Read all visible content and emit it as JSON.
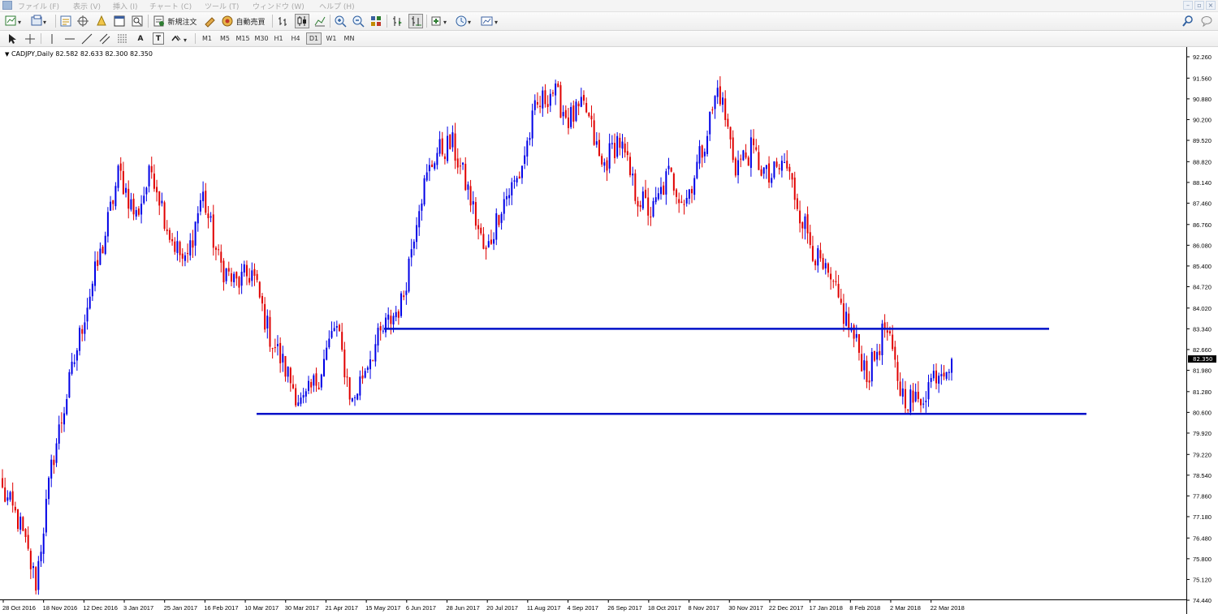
{
  "menubar": {
    "items": [
      "ファイル (F)",
      "表示 (V)",
      "挿入 (I)",
      "チャート (C)",
      "ツール (T)",
      "ウィンドウ (W)",
      "ヘルプ (H)"
    ],
    "window_controls": [
      "minimize",
      "restore",
      "close"
    ]
  },
  "toolbar": {
    "new_order_label": "新規注文",
    "auto_trading_label": "自動売買",
    "icons": [
      "new-chart-icon",
      "profiles-icon",
      "market-watch-icon",
      "data-window-icon",
      "navigator-icon",
      "terminal-icon",
      "tester-icon",
      "bar-chart-icon",
      "candlestick-icon",
      "line-chart-icon",
      "zoom-in-icon",
      "zoom-out-icon",
      "tile-windows-icon",
      "chart-shift-icon",
      "auto-scroll-icon",
      "indicators-icon",
      "periods-icon",
      "templates-icon",
      "search-icon",
      "chat-icon"
    ]
  },
  "drawing_toolbar": {
    "tools": [
      "cursor-icon",
      "crosshair-icon",
      "vertical-line-icon",
      "horizontal-line-icon",
      "trendline-icon",
      "equidistant-channel-icon",
      "fibonacci-icon",
      "text-icon",
      "text-label-icon",
      "arrows-icon"
    ],
    "text_tool_label": "A",
    "label_tool_label": "T",
    "timeframes": [
      "M1",
      "M5",
      "M15",
      "M30",
      "H1",
      "H4",
      "D1",
      "W1",
      "MN"
    ],
    "active_timeframe": "D1"
  },
  "chart": {
    "header": "CADJPY,Daily  82.582 82.633 82.300 82.350",
    "current_price_label": "82.350"
  },
  "colors": {
    "bull": "#0000e6",
    "bear": "#e00000",
    "lines": "#0010c8",
    "price_tag": "#000000"
  },
  "chart_data": {
    "type": "candlestick",
    "symbol": "CADJPY",
    "timeframe": "Daily",
    "ohlc_header": {
      "open": 82.582,
      "high": 82.633,
      "low": 82.3,
      "close": 82.35
    },
    "y_ticks": [
      "92.260",
      "91.560",
      "90.880",
      "90.200",
      "89.520",
      "88.820",
      "88.140",
      "87.460",
      "86.760",
      "86.080",
      "85.400",
      "84.720",
      "84.020",
      "83.340",
      "82.660",
      "81.980",
      "81.280",
      "80.600",
      "79.920",
      "79.220",
      "78.540",
      "77.860",
      "77.180",
      "76.480",
      "75.800",
      "75.120",
      "74.440"
    ],
    "ylim": [
      74.44,
      92.26
    ],
    "x_ticks": [
      "28 Oct 2016",
      "18 Nov 2016",
      "12 Dec 2016",
      "3 Jan 2017",
      "25 Jan 2017",
      "16 Feb 2017",
      "10 Mar 2017",
      "30 Mar 2017",
      "21 Apr 2017",
      "15 May 2017",
      "6 Jun 2017",
      "28 Jun 2017",
      "20 Jul 2017",
      "11 Aug 2017",
      "4 Sep 2017",
      "26 Sep 2017",
      "18 Oct 2017",
      "8 Nov 2017",
      "30 Nov 2017",
      "22 Dec 2017",
      "17 Jan 2018",
      "8 Feb 2018",
      "2 Mar 2018",
      "22 Mar 2018"
    ],
    "key_prices": [
      {
        "date_index": 0,
        "price": 78.0
      },
      {
        "date_index": 1,
        "price": 77.0
      },
      {
        "date_index": 2,
        "price": 75.0
      },
      {
        "date_index": 3,
        "price": 79.0
      },
      {
        "date_index": 4,
        "price": 81.5
      },
      {
        "date_index": 5,
        "price": 84.0
      },
      {
        "date_index": 6,
        "price": 86.0
      },
      {
        "date_index": 7,
        "price": 88.5
      },
      {
        "date_index": 8,
        "price": 87.0
      },
      {
        "date_index": 9,
        "price": 88.6
      },
      {
        "date_index": 10,
        "price": 86.5
      },
      {
        "date_index": 11,
        "price": 85.4
      },
      {
        "date_index": 12,
        "price": 87.8
      },
      {
        "date_index": 13,
        "price": 85.5
      },
      {
        "date_index": 14,
        "price": 84.8
      },
      {
        "date_index": 15,
        "price": 85.2
      },
      {
        "date_index": 16,
        "price": 83.2
      },
      {
        "date_index": 17,
        "price": 82.0
      },
      {
        "date_index": 18,
        "price": 80.8
      },
      {
        "date_index": 19,
        "price": 81.8
      },
      {
        "date_index": 20,
        "price": 83.5
      },
      {
        "date_index": 21,
        "price": 80.9
      },
      {
        "date_index": 22,
        "price": 82.4
      },
      {
        "date_index": 23,
        "price": 83.4
      },
      {
        "date_index": 24,
        "price": 84.2
      },
      {
        "date_index": 25,
        "price": 87.5
      },
      {
        "date_index": 26,
        "price": 89.1
      },
      {
        "date_index": 27,
        "price": 89.4
      },
      {
        "date_index": 28,
        "price": 87.8
      },
      {
        "date_index": 29,
        "price": 85.7
      },
      {
        "date_index": 30,
        "price": 87.5
      },
      {
        "date_index": 31,
        "price": 88.3
      },
      {
        "date_index": 32,
        "price": 90.5
      },
      {
        "date_index": 33,
        "price": 91.2
      },
      {
        "date_index": 34,
        "price": 90.2
      },
      {
        "date_index": 35,
        "price": 90.6
      },
      {
        "date_index": 36,
        "price": 88.6
      },
      {
        "date_index": 37,
        "price": 89.6
      },
      {
        "date_index": 38,
        "price": 87.8
      },
      {
        "date_index": 39,
        "price": 87.1
      },
      {
        "date_index": 40,
        "price": 88.4
      },
      {
        "date_index": 41,
        "price": 87.5
      },
      {
        "date_index": 42,
        "price": 89.2
      },
      {
        "date_index": 43,
        "price": 91.3
      },
      {
        "date_index": 44,
        "price": 88.7
      },
      {
        "date_index": 45,
        "price": 89.2
      },
      {
        "date_index": 46,
        "price": 88.2
      },
      {
        "date_index": 47,
        "price": 88.8
      },
      {
        "date_index": 48,
        "price": 87.0
      },
      {
        "date_index": 49,
        "price": 85.5
      },
      {
        "date_index": 50,
        "price": 84.5
      },
      {
        "date_index": 51,
        "price": 83.2
      },
      {
        "date_index": 52,
        "price": 81.8
      },
      {
        "date_index": 53,
        "price": 83.4
      },
      {
        "date_index": 54,
        "price": 81.2
      },
      {
        "date_index": 55,
        "price": 80.9
      },
      {
        "date_index": 56,
        "price": 81.9
      },
      {
        "date_index": 57,
        "price": 82.35
      }
    ],
    "horizontal_lines": [
      {
        "price": 83.34,
        "x_start_date": "15 May 2017",
        "x_end_date": "after 22 Mar 2018"
      },
      {
        "price": 80.55,
        "x_start_date": "before 30 Mar 2017",
        "x_end_date": "after 22 Mar 2018"
      }
    ]
  }
}
